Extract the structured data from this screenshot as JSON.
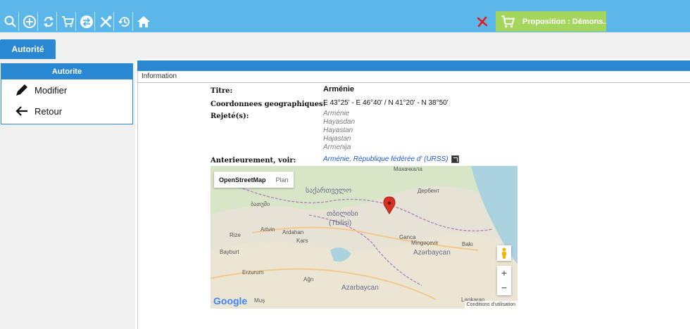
{
  "toolbar": {
    "buttons": [
      "search-icon",
      "add-circle-icon",
      "refresh-icon",
      "cart-icon",
      "swap-icon",
      "tools-icon",
      "history-icon",
      "home-icon"
    ],
    "proposition_label": "Proposition : Démons...",
    "accent": "#5bb7ea",
    "proposition_color": "#a4d65e"
  },
  "tabs": [
    {
      "label": "Autorité"
    }
  ],
  "sidebar": {
    "title": "Autorite",
    "items": [
      {
        "label": "Modifier",
        "icon": "pencil-icon"
      },
      {
        "label": "Retour",
        "icon": "arrow-left-icon"
      }
    ]
  },
  "main": {
    "section": "Information",
    "fields": {
      "title_label": "Titre:",
      "title_value": "Arménie",
      "coords_label": "Coordonnees geographiques:",
      "coords_value": "E 43°25' - E 46°40' / N 41°20' - N 38°50'",
      "rejected_label": "Rejeté(s):",
      "rejected": [
        "Arménie",
        "Hayasdan",
        "Hayastan",
        "Hajastan",
        "Armenija"
      ],
      "see_label": "Anterieurement, voir:",
      "see_value": "Arménie, République fédérée d' (URSS)"
    }
  },
  "map": {
    "type_options": [
      "OpenStreetMap",
      "Plan"
    ],
    "labels": [
      "Махачкала",
      "საქართველო",
      "Дербент",
      "ბათუმი",
      "თბილისი",
      "(Tbilisi)",
      "Artvin",
      "Ardahan",
      "Rize",
      "Kars",
      "Ganca",
      "Mingəçevir",
      "Bakı",
      "Azərbaycan",
      "Bayburt",
      "Erzurum",
      "Ağrı",
      "Azarbaycan",
      "Muş",
      "Lankaran",
      "Google",
      "Conditions d'utilisation"
    ]
  }
}
